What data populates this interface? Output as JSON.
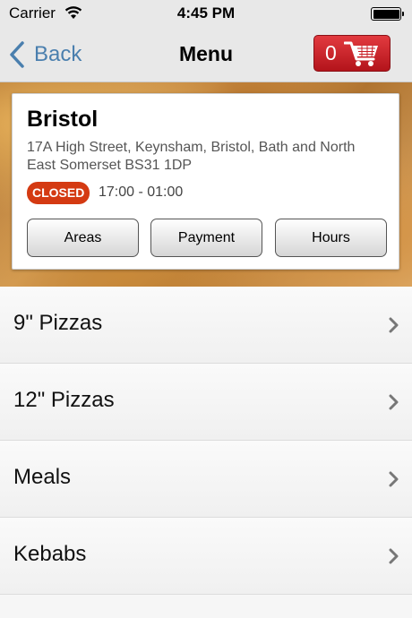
{
  "status_bar": {
    "carrier": "Carrier",
    "time": "4:45 PM",
    "wifi_icon": "wifi-icon",
    "battery_icon": "battery-icon",
    "battery_level": 1.0
  },
  "nav": {
    "back_label": "Back",
    "title": "Menu",
    "cart_count": "0",
    "cart_icon": "shopping-cart-icon",
    "accent_color": "#4a7fae",
    "cart_color": "#d42a30"
  },
  "store": {
    "name": "Bristol",
    "address": "17A High Street, Keynsham, Bristol, Bath and North East Somerset BS31 1DP",
    "status": "CLOSED",
    "status_color": "#d43a12",
    "hours": "17:00 - 01:00",
    "buttons": {
      "areas": "Areas",
      "payment": "Payment",
      "hours": "Hours"
    }
  },
  "menu": {
    "items": [
      {
        "label": "9\" Pizzas"
      },
      {
        "label": "12\" Pizzas"
      },
      {
        "label": "Meals"
      },
      {
        "label": "Kebabs"
      }
    ],
    "chevron_icon": "chevron-right-icon"
  }
}
